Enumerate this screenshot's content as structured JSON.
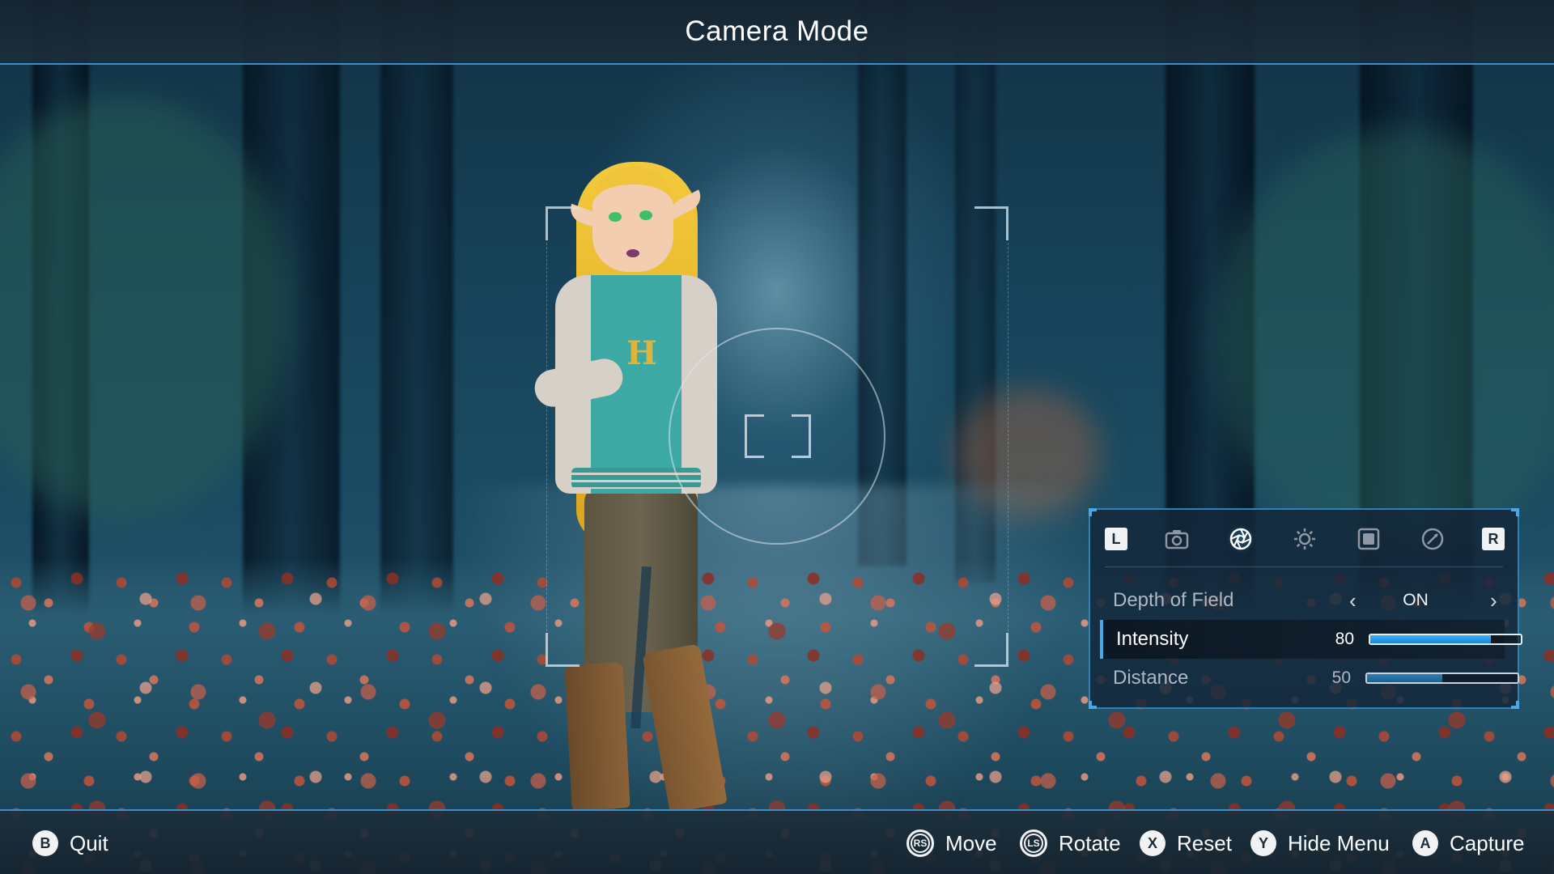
{
  "header": {
    "title": "Camera Mode"
  },
  "panel": {
    "tabs": [
      {
        "icon": "left-bumper",
        "label": "L"
      },
      {
        "icon": "camera-icon"
      },
      {
        "icon": "aperture-icon",
        "active": true
      },
      {
        "icon": "brightness-icon"
      },
      {
        "icon": "frame-icon"
      },
      {
        "icon": "filter-icon"
      },
      {
        "icon": "right-bumper",
        "label": "R"
      }
    ],
    "settings": {
      "depth_of_field": {
        "label": "Depth of Field",
        "value": "ON"
      },
      "intensity": {
        "label": "Intensity",
        "value": "80",
        "level_percent": 80
      },
      "distance": {
        "label": "Distance",
        "value": "50",
        "level_percent": 50
      }
    }
  },
  "controls": [
    {
      "button": "B",
      "label": "Quit"
    },
    {
      "button": "RS",
      "label": "Move"
    },
    {
      "button": "LS",
      "label": "Rotate"
    },
    {
      "button": "X",
      "label": "Reset"
    },
    {
      "button": "Y",
      "label": "Hide Menu"
    },
    {
      "button": "A",
      "label": "Capture"
    }
  ],
  "colors": {
    "accent": "#3a8fc8",
    "slider_fill": "#2a9ef0",
    "panel_bg": "#14283a"
  }
}
